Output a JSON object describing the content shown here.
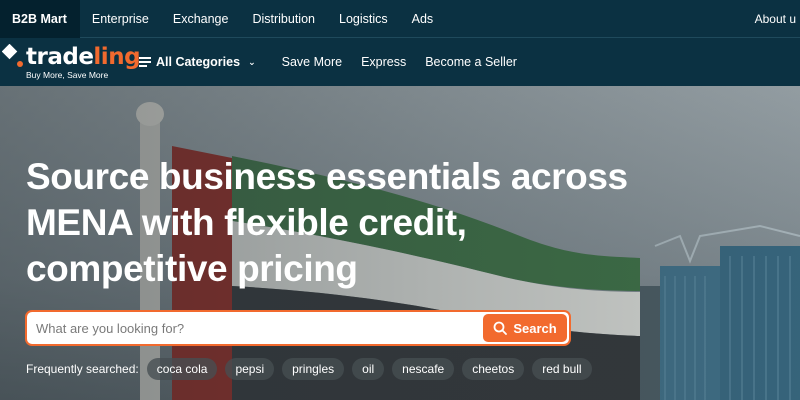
{
  "topbar": {
    "tabs": [
      "B2B Mart",
      "Enterprise",
      "Exchange",
      "Distribution",
      "Logistics",
      "Ads"
    ],
    "right_link": "About u"
  },
  "navbar": {
    "logo_text_main": "trade",
    "logo_text_accent": "ling",
    "logo_tagline": "Buy More, Save More",
    "all_categories": "All Categories",
    "items": [
      "Save More",
      "Express",
      "Become a Seller"
    ]
  },
  "hero": {
    "title": "Source business essentials across MENA with flexible credit, competitive pricing",
    "search_placeholder": "What are you looking for?",
    "search_button": "Search",
    "frequently_label": "Frequently searched:",
    "chips": [
      "coca cola",
      "pepsi",
      "pringles",
      "oil",
      "nescafe",
      "cheetos",
      "red bull"
    ]
  },
  "colors": {
    "brand_orange": "#f26a2e",
    "header_bg": "#0b3142"
  }
}
